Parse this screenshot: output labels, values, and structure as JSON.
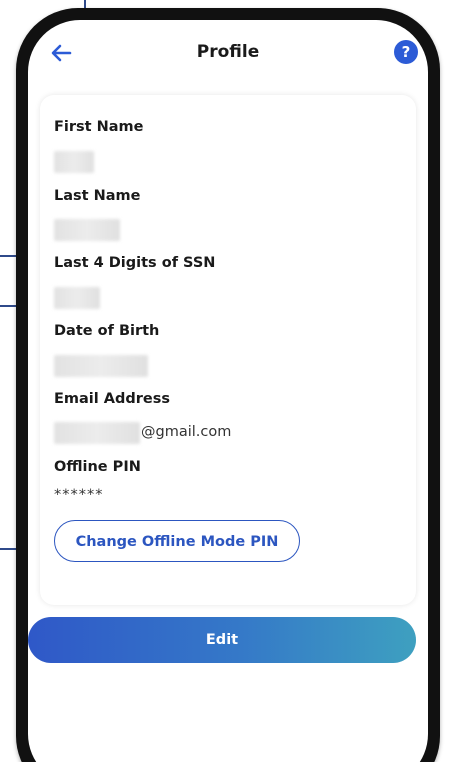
{
  "header": {
    "title": "Profile",
    "help_glyph": "?",
    "back_icon": "arrow-left-icon",
    "help_icon": "question-circle-icon"
  },
  "profile": {
    "first_name_label": "First Name",
    "last_name_label": "Last Name",
    "ssn_label": "Last 4 Digits of SSN",
    "dob_label": "Date of Birth",
    "email_label": "Email Address",
    "email_domain": "@gmail.com",
    "pin_label": "Offline PIN",
    "pin_value": "******",
    "change_pin_button": "Change Offline Mode PIN"
  },
  "actions": {
    "edit_label": "Edit"
  },
  "colors": {
    "accent": "#2c56c0",
    "help_icon_bg": "#2c5bd6",
    "edit_gradient_start": "#2f58c8",
    "edit_gradient_end": "#3ea0c0"
  }
}
